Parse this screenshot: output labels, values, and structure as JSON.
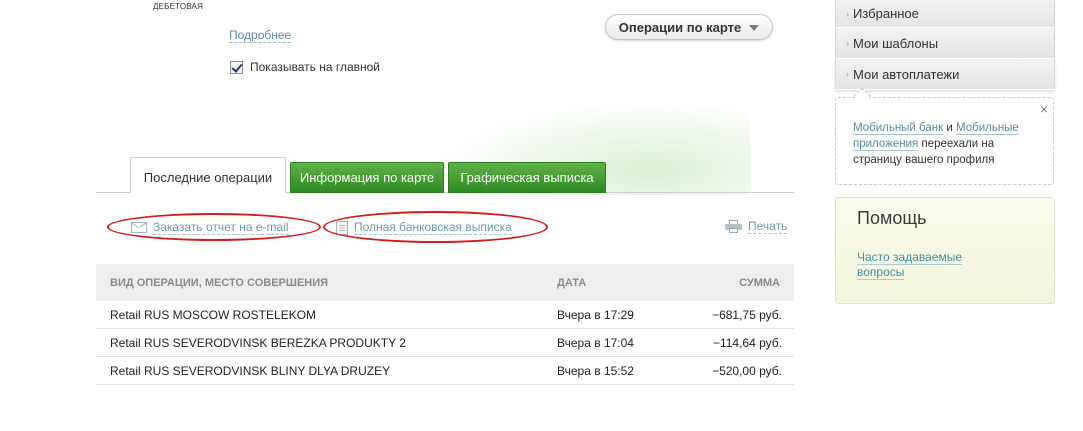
{
  "card": {
    "type_label": "ДЕБЕТОВАЯ",
    "more_link": "Подробнее",
    "show_on_main_label": "Показывать на главной",
    "show_on_main_checked": true,
    "operations_button": "Операции по карте"
  },
  "tabs": [
    {
      "label": "Последние операции",
      "active": true
    },
    {
      "label": "Информация по карте",
      "active": false
    },
    {
      "label": "Графическая выписка",
      "active": false
    }
  ],
  "actions": {
    "email_report": "Заказать отчет на e-mail",
    "full_statement": "Полная банковская выписка",
    "print": "Печать"
  },
  "table": {
    "headers": {
      "operation": "ВИД ОПЕРАЦИИ, МЕСТО СОВЕРШЕНИЯ",
      "date": "ДАТА",
      "amount": "СУММА"
    },
    "rows": [
      {
        "operation": "Retail RUS MOSCOW ROSTELEKOM",
        "date": "Вчера в 17:29",
        "amount": "−681,75 руб."
      },
      {
        "operation": "Retail RUS SEVERODVINSK BEREZKA PRODUKTY 2",
        "date": "Вчера в 17:04",
        "amount": "−114,64 руб."
      },
      {
        "operation": "Retail RUS SEVERODVINSK BLINY DLYA DRUZEY",
        "date": "Вчера в 15:52",
        "amount": "−520,00 руб."
      }
    ]
  },
  "sidebar": {
    "menu": [
      {
        "label": "Избранное"
      },
      {
        "label": "Мои шаблоны"
      },
      {
        "label": "Мои автоплатежи"
      }
    ],
    "notice": {
      "link_mobile_bank": "Мобильный банк",
      "and": "и",
      "link_mobile_apps": "Мобильные приложения",
      "text_rest": "переехали на страницу вашего профиля",
      "close": "×"
    },
    "help": {
      "title": "Помощь",
      "faq_link": "Часто задаваемые вопросы"
    }
  },
  "colors": {
    "tab_green": "#3f9a2e",
    "link": "#5b8a9c",
    "highlight_oval": "#d21d1d",
    "help_bg": "#f6f8e4"
  }
}
